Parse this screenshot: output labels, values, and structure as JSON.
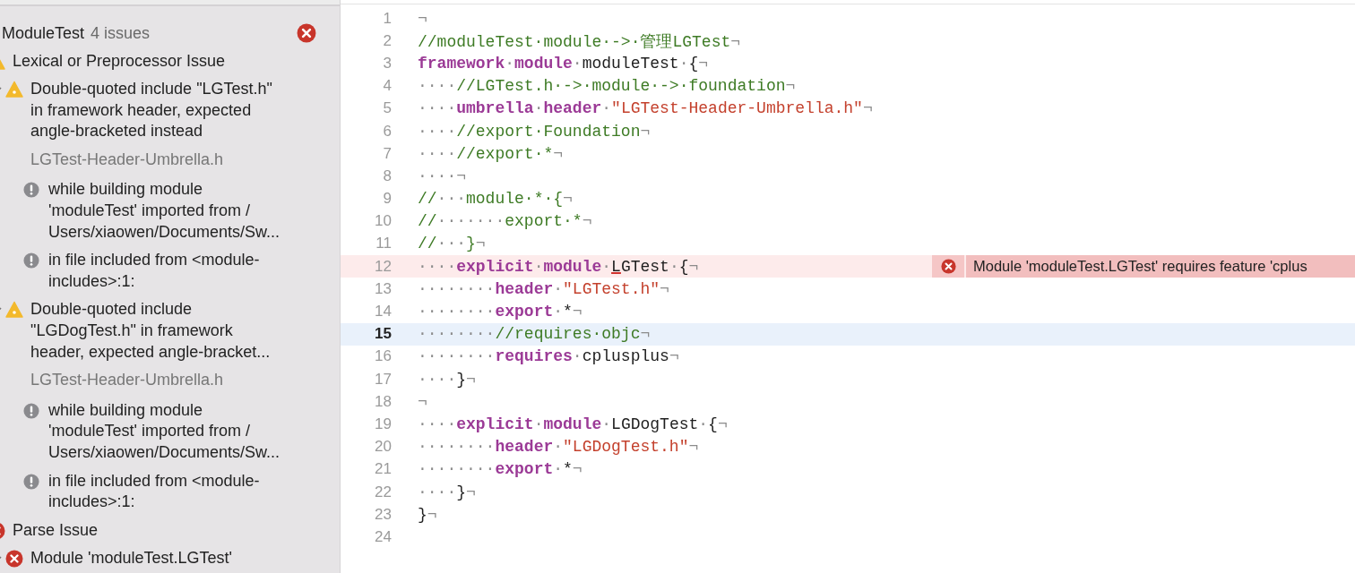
{
  "issues": {
    "title": "ModuleTest",
    "count": "4 issues",
    "kind": "error",
    "children": [
      {
        "kind": "warning",
        "text": "Lexical or Preprocessor Issue",
        "children": [
          {
            "kind": "warning",
            "text": "Double-quoted include \"LGTest.h\"\nin framework header, expected\nangle-bracketed instead",
            "file": "LGTest-Header-Umbrella.h",
            "expanded": true,
            "children": [
              {
                "kind": "note",
                "text": "while building module\n'moduleTest' imported from /\nUsers/xiaowen/Documents/Sw..."
              },
              {
                "kind": "note",
                "text": "in file included from <module-\nincludes>:1:"
              }
            ]
          },
          {
            "kind": "warning",
            "text": "Double-quoted include\n\"LGDogTest.h\" in framework\nheader, expected angle-bracket...",
            "file": "LGTest-Header-Umbrella.h",
            "expanded": true,
            "children": [
              {
                "kind": "note",
                "text": "while building module\n'moduleTest' imported from /\nUsers/xiaowen/Documents/Sw..."
              },
              {
                "kind": "note",
                "text": "in file included from <module-\nincludes>:1:"
              }
            ]
          }
        ]
      },
      {
        "kind": "error",
        "text": "Parse Issue",
        "children": [
          {
            "kind": "error",
            "text": "Module 'moduleTest.LGTest'",
            "expanded": true
          }
        ]
      }
    ]
  },
  "editor": {
    "lines": [
      {
        "n": "1",
        "kind": "code",
        "tokens": [
          {
            "kind": "ws",
            "text": "¬"
          }
        ]
      },
      {
        "n": "2",
        "kind": "code",
        "tokens": [
          {
            "kind": "comment",
            "text": "//moduleTest·module·->·管理LGTest"
          },
          {
            "kind": "ws",
            "text": "¬"
          }
        ]
      },
      {
        "n": "3",
        "kind": "code",
        "tokens": [
          {
            "kind": "kw",
            "text": "framework"
          },
          {
            "kind": "ws",
            "text": "·"
          },
          {
            "kind": "kw",
            "text": "module"
          },
          {
            "kind": "ws",
            "text": "·"
          },
          {
            "kind": "plain",
            "text": "moduleTest"
          },
          {
            "kind": "ws",
            "text": "·"
          },
          {
            "kind": "plain",
            "text": "{"
          },
          {
            "kind": "ws",
            "text": "¬"
          }
        ]
      },
      {
        "n": "4",
        "kind": "code",
        "tokens": [
          {
            "kind": "ws",
            "text": "····"
          },
          {
            "kind": "comment",
            "text": "//LGTest.h·->·module·->·foundation"
          },
          {
            "kind": "ws",
            "text": "¬"
          }
        ]
      },
      {
        "n": "5",
        "kind": "code",
        "tokens": [
          {
            "kind": "ws",
            "text": "····"
          },
          {
            "kind": "kw",
            "text": "umbrella"
          },
          {
            "kind": "ws",
            "text": "·"
          },
          {
            "kind": "kw",
            "text": "header"
          },
          {
            "kind": "ws",
            "text": "·"
          },
          {
            "kind": "str",
            "text": "\"LGTest-Header-Umbrella.h\""
          },
          {
            "kind": "ws",
            "text": "¬"
          }
        ]
      },
      {
        "n": "6",
        "kind": "code",
        "tokens": [
          {
            "kind": "ws",
            "text": "····"
          },
          {
            "kind": "comment",
            "text": "//export·Foundation"
          },
          {
            "kind": "ws",
            "text": "¬"
          }
        ]
      },
      {
        "n": "7",
        "kind": "code",
        "tokens": [
          {
            "kind": "ws",
            "text": "····"
          },
          {
            "kind": "comment",
            "text": "//export·*"
          },
          {
            "kind": "ws",
            "text": "¬"
          }
        ]
      },
      {
        "n": "8",
        "kind": "code",
        "tokens": [
          {
            "kind": "ws",
            "text": "····¬"
          }
        ]
      },
      {
        "n": "9",
        "kind": "code",
        "tokens": [
          {
            "kind": "comment",
            "text": "//"
          },
          {
            "kind": "ws",
            "text": "···"
          },
          {
            "kind": "comment",
            "text": "module·*·{"
          },
          {
            "kind": "ws",
            "text": "¬"
          }
        ]
      },
      {
        "n": "10",
        "kind": "code",
        "tokens": [
          {
            "kind": "comment",
            "text": "//"
          },
          {
            "kind": "ws",
            "text": "·······"
          },
          {
            "kind": "comment",
            "text": "export·*"
          },
          {
            "kind": "ws",
            "text": "¬"
          }
        ]
      },
      {
        "n": "11",
        "kind": "code",
        "tokens": [
          {
            "kind": "comment",
            "text": "//"
          },
          {
            "kind": "ws",
            "text": "···"
          },
          {
            "kind": "comment",
            "text": "}"
          },
          {
            "kind": "ws",
            "text": "¬"
          }
        ]
      },
      {
        "n": "12",
        "kind": "error",
        "tokens": [
          {
            "kind": "ws",
            "text": "····"
          },
          {
            "kind": "kw",
            "text": "explicit"
          },
          {
            "kind": "ws",
            "text": "·"
          },
          {
            "kind": "kw",
            "text": "module"
          },
          {
            "kind": "ws",
            "text": "·"
          },
          {
            "kind": "err",
            "text": "L"
          },
          {
            "kind": "plain",
            "text": "GTest"
          },
          {
            "kind": "ws",
            "text": "·"
          },
          {
            "kind": "plain",
            "text": "{"
          },
          {
            "kind": "ws",
            "text": "¬"
          }
        ],
        "annotation": {
          "kind": "error",
          "text": "Module 'moduleTest.LGTest' requires feature 'cplus"
        }
      },
      {
        "n": "13",
        "kind": "code",
        "tokens": [
          {
            "kind": "ws",
            "text": "········"
          },
          {
            "kind": "kw",
            "text": "header"
          },
          {
            "kind": "ws",
            "text": "·"
          },
          {
            "kind": "str",
            "text": "\"LGTest.h\""
          },
          {
            "kind": "ws",
            "text": "¬"
          }
        ]
      },
      {
        "n": "14",
        "kind": "code",
        "tokens": [
          {
            "kind": "ws",
            "text": "········"
          },
          {
            "kind": "kw",
            "text": "export"
          },
          {
            "kind": "ws",
            "text": "·"
          },
          {
            "kind": "plain",
            "text": "*"
          },
          {
            "kind": "ws",
            "text": "¬"
          }
        ]
      },
      {
        "n": "15",
        "kind": "current",
        "tokens": [
          {
            "kind": "ws",
            "text": "········"
          },
          {
            "kind": "comment",
            "text": "//requires·objc"
          },
          {
            "kind": "ws",
            "text": "¬"
          }
        ]
      },
      {
        "n": "16",
        "kind": "code",
        "tokens": [
          {
            "kind": "ws",
            "text": "········"
          },
          {
            "kind": "kw",
            "text": "requires"
          },
          {
            "kind": "ws",
            "text": "·"
          },
          {
            "kind": "plain",
            "text": "cplusplus"
          },
          {
            "kind": "ws",
            "text": "¬"
          }
        ]
      },
      {
        "n": "17",
        "kind": "code",
        "tokens": [
          {
            "kind": "ws",
            "text": "····"
          },
          {
            "kind": "plain",
            "text": "}"
          },
          {
            "kind": "ws",
            "text": "¬"
          }
        ]
      },
      {
        "n": "18",
        "kind": "code",
        "tokens": [
          {
            "kind": "ws",
            "text": "¬"
          }
        ]
      },
      {
        "n": "19",
        "kind": "code",
        "tokens": [
          {
            "kind": "ws",
            "text": "····"
          },
          {
            "kind": "kw",
            "text": "explicit"
          },
          {
            "kind": "ws",
            "text": "·"
          },
          {
            "kind": "kw",
            "text": "module"
          },
          {
            "kind": "ws",
            "text": "·"
          },
          {
            "kind": "plain",
            "text": "LGDogTest"
          },
          {
            "kind": "ws",
            "text": "·"
          },
          {
            "kind": "plain",
            "text": "{"
          },
          {
            "kind": "ws",
            "text": "¬"
          }
        ]
      },
      {
        "n": "20",
        "kind": "code",
        "tokens": [
          {
            "kind": "ws",
            "text": "········"
          },
          {
            "kind": "kw",
            "text": "header"
          },
          {
            "kind": "ws",
            "text": "·"
          },
          {
            "kind": "str",
            "text": "\"LGDogTest.h\""
          },
          {
            "kind": "ws",
            "text": "¬"
          }
        ]
      },
      {
        "n": "21",
        "kind": "code",
        "tokens": [
          {
            "kind": "ws",
            "text": "········"
          },
          {
            "kind": "kw",
            "text": "export"
          },
          {
            "kind": "ws",
            "text": "·"
          },
          {
            "kind": "plain",
            "text": "*"
          },
          {
            "kind": "ws",
            "text": "¬"
          }
        ]
      },
      {
        "n": "22",
        "kind": "code",
        "tokens": [
          {
            "kind": "ws",
            "text": "····"
          },
          {
            "kind": "plain",
            "text": "}"
          },
          {
            "kind": "ws",
            "text": "¬"
          }
        ]
      },
      {
        "n": "23",
        "kind": "code",
        "tokens": [
          {
            "kind": "plain",
            "text": "}"
          },
          {
            "kind": "ws",
            "text": "¬"
          }
        ]
      },
      {
        "n": "24",
        "kind": "code"
      }
    ]
  }
}
